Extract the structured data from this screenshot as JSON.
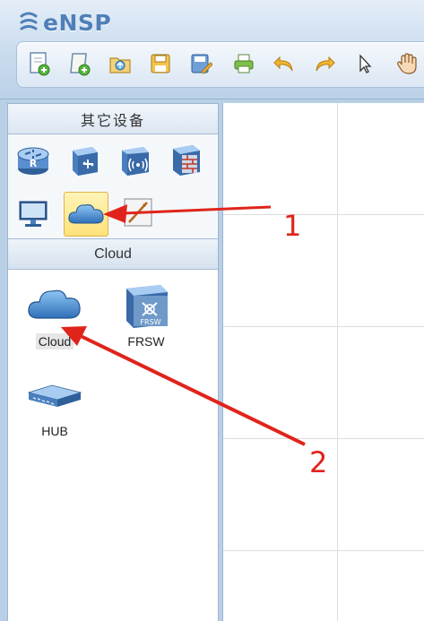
{
  "app": {
    "title": "eNSP"
  },
  "toolbar": {
    "buttons": [
      {
        "id": "new",
        "icon": "new-topology-icon"
      },
      {
        "id": "new-example",
        "icon": "new-example-icon"
      },
      {
        "id": "open",
        "icon": "open-folder-icon"
      },
      {
        "id": "save",
        "icon": "save-icon"
      },
      {
        "id": "save-as",
        "icon": "save-as-icon"
      },
      {
        "id": "print",
        "icon": "print-icon"
      },
      {
        "id": "undo",
        "icon": "undo-icon"
      },
      {
        "id": "redo",
        "icon": "redo-icon"
      },
      {
        "id": "select",
        "icon": "pointer-icon"
      },
      {
        "id": "pan",
        "icon": "hand-icon"
      }
    ]
  },
  "panel": {
    "header": "其它设备",
    "palette": [
      {
        "icon": "router-icon"
      },
      {
        "icon": "switch-icon"
      },
      {
        "icon": "wireless-icon"
      },
      {
        "icon": "firewall-icon"
      },
      {
        "icon": "pc-icon"
      },
      {
        "icon": "cloud-icon",
        "selected": true
      },
      {
        "icon": "link-icon"
      }
    ],
    "section_title": "Cloud",
    "devices": [
      {
        "label": "Cloud",
        "icon": "cloud-icon"
      },
      {
        "label": "FRSW",
        "icon": "frsw-icon",
        "badge": "FRSW"
      },
      {
        "label": "HUB",
        "icon": "hub-icon"
      }
    ]
  },
  "annotations": [
    {
      "label": "1"
    },
    {
      "label": "2"
    }
  ],
  "colors": {
    "accent": "#4f7fb8",
    "annotation": "#e0241b",
    "selected": "#ffe27a"
  }
}
